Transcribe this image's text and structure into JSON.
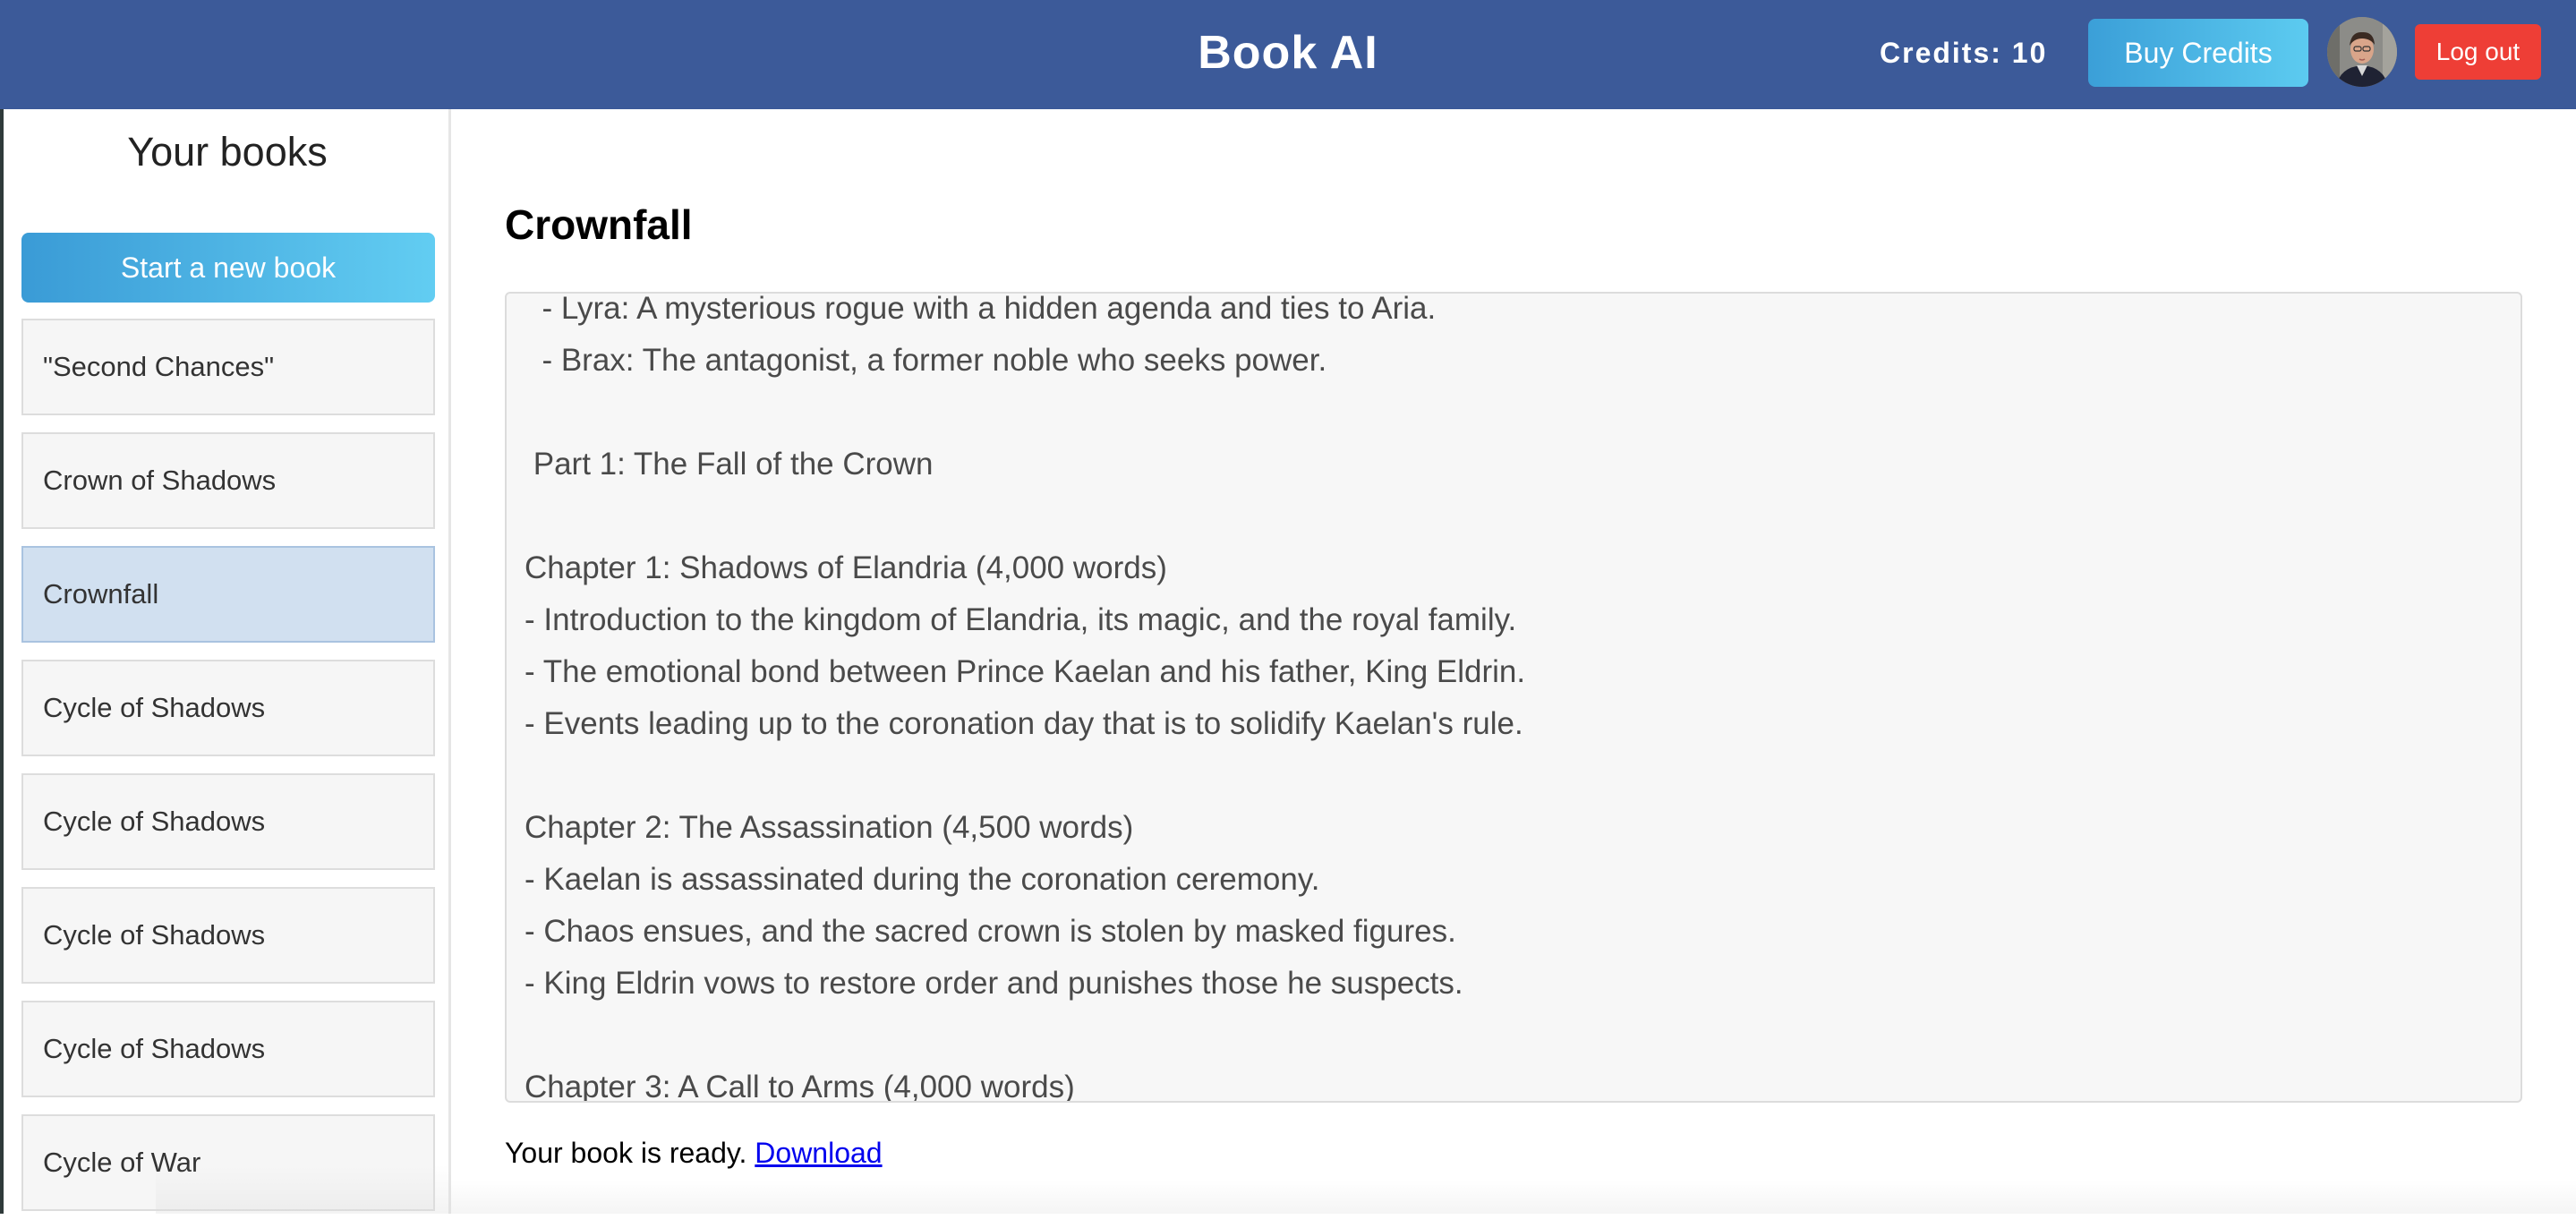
{
  "header": {
    "app_title": "Book AI",
    "credits_text": "Credits: 10",
    "buy_credits_label": "Buy Credits",
    "logout_label": "Log out"
  },
  "sidebar": {
    "title": "Your books",
    "new_book_label": "Start a new book",
    "books": [
      "\"Second Chances\"",
      "Crown of Shadows",
      "Crownfall",
      "Cycle of Shadows",
      "Cycle of Shadows",
      "Cycle of Shadows",
      "Cycle of Shadows",
      "Cycle of War"
    ],
    "selected_book": "Crownfall"
  },
  "main": {
    "book_title": "Crownfall",
    "outline_lines": [
      "  - Lyra: A mysterious rogue with a hidden agenda and ties to Aria.",
      "  - Brax: The antagonist, a former noble who seeks power.",
      "",
      " Part 1: The Fall of the Crown",
      "",
      "Chapter 1: Shadows of Elandria (4,000 words)",
      "- Introduction to the kingdom of Elandria, its magic, and the royal family.",
      "- The emotional bond between Prince Kaelan and his father, King Eldrin.",
      "- Events leading up to the coronation day that is to solidify Kaelan's rule.",
      "",
      "Chapter 2: The Assassination (4,500 words)",
      "- Kaelan is assassinated during the coronation ceremony.",
      "- Chaos ensues, and the sacred crown is stolen by masked figures.",
      "- King Eldrin vows to restore order and punishes those he suspects.",
      "",
      "Chapter 3: A Call to Arms (4,000 words)"
    ],
    "ready_text": "Your book is ready. ",
    "download_label": "Download"
  },
  "colors": {
    "header_bg": "#3c5a99",
    "button_gradient_start": "#3b9fd8",
    "button_gradient_end": "#5ccbf0",
    "logout_bg": "#ee3e36",
    "selected_item_bg": "#d1e0f0",
    "outline_bg": "#f7f7f7",
    "link": "#0000ee"
  },
  "icons": {
    "avatar": "user-avatar-photo"
  }
}
